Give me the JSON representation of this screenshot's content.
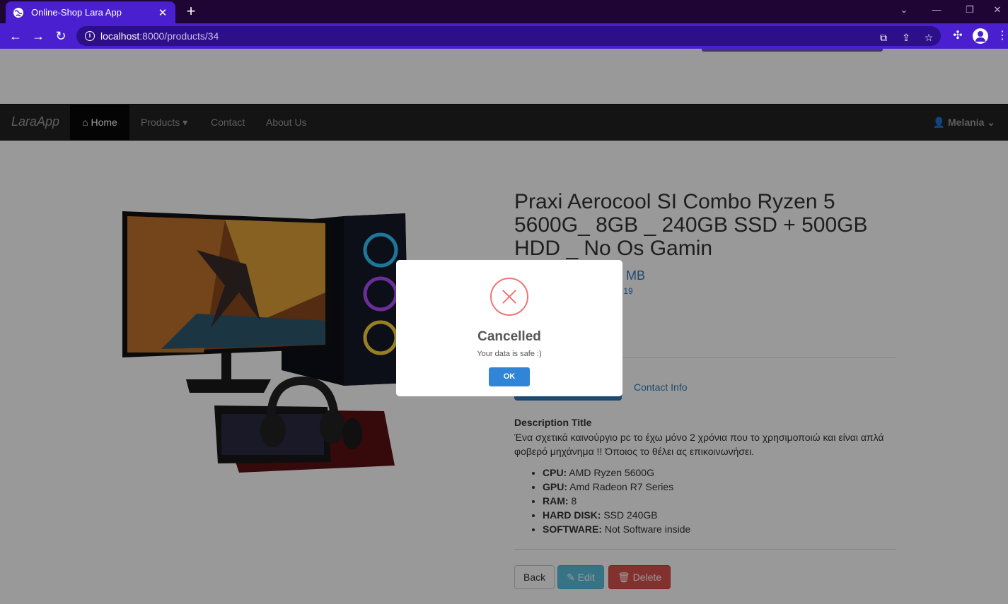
{
  "browser": {
    "tab_title": "Online-Shop Lara App",
    "tab_close": "✕",
    "new_tab": "+",
    "url_host": "localhost",
    "url_path": ":8000/products/34",
    "window_controls": [
      "⌄",
      "—",
      "❐",
      "✕"
    ]
  },
  "navbar": {
    "brand": "LaraApp",
    "home": "Home",
    "products": "Products",
    "contact": "Contact",
    "about": "About Us",
    "user": "Melania"
  },
  "product": {
    "title": "Praxi Aerocool SI Combo Ryzen 5 5600G_ 8GB _ 240GB SSD + 500GB HDD _ No Os Gamin",
    "price_partial": "MB",
    "date_partial": ":19",
    "tab_contact": "Contact Info",
    "description_title": "Description Title",
    "description": "Ένα σχετικά καινούργιο pc το έχω μόνο 2 χρόνια που το χρησιμοποιώ και είναι απλά φοβερό μηχάνημα !! Όποιος το θέλει ας επικοινωνήσει.",
    "specs": [
      {
        "label": "CPU:",
        "value": "AMD Ryzen 5600G"
      },
      {
        "label": "GPU:",
        "value": "Amd Radeon R7 Series"
      },
      {
        "label": "RAM:",
        "value": "8"
      },
      {
        "label": "HARD DISK:",
        "value": "SSD 240GB"
      },
      {
        "label": "SOFTWARE:",
        "value": "Not Software inside"
      }
    ],
    "buttons": {
      "back": "Back",
      "edit": "Edit",
      "delete": "Delete"
    }
  },
  "modal": {
    "title": "Cancelled",
    "text": "Your data is safe :)",
    "ok": "OK"
  },
  "colors": {
    "browser_accent": "#4a1fd0",
    "link": "#337ab7",
    "error": "#f27474",
    "confirm": "#3085d6"
  }
}
